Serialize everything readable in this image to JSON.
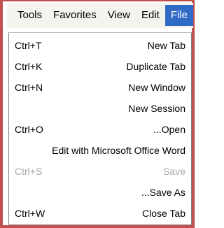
{
  "menubar": {
    "items": [
      {
        "label": "Tools"
      },
      {
        "label": "Favorites"
      },
      {
        "label": "View"
      },
      {
        "label": "Edit"
      },
      {
        "label": "File"
      }
    ]
  },
  "file_menu": {
    "items": [
      {
        "shortcut": "Ctrl+T",
        "label": "New Tab"
      },
      {
        "shortcut": "Ctrl+K",
        "label": "Duplicate Tab"
      },
      {
        "shortcut": "Ctrl+N",
        "label": "New Window"
      },
      {
        "shortcut": "",
        "label": "New Session"
      },
      {
        "shortcut": "Ctrl+O",
        "label": "...Open"
      },
      {
        "shortcut": "",
        "label": "Edit with Microsoft Office Word"
      },
      {
        "shortcut": "Ctrl+S",
        "label": "Save",
        "disabled": true
      },
      {
        "shortcut": "",
        "label": "...Save As"
      },
      {
        "shortcut": "Ctrl+W",
        "label": "Close Tab"
      }
    ]
  },
  "colors": {
    "frame": "#c0504d",
    "menubar_bg": "#f4f3ee",
    "active_menu_bg": "#316ac5",
    "disabled_text": "#a8a8a8"
  }
}
